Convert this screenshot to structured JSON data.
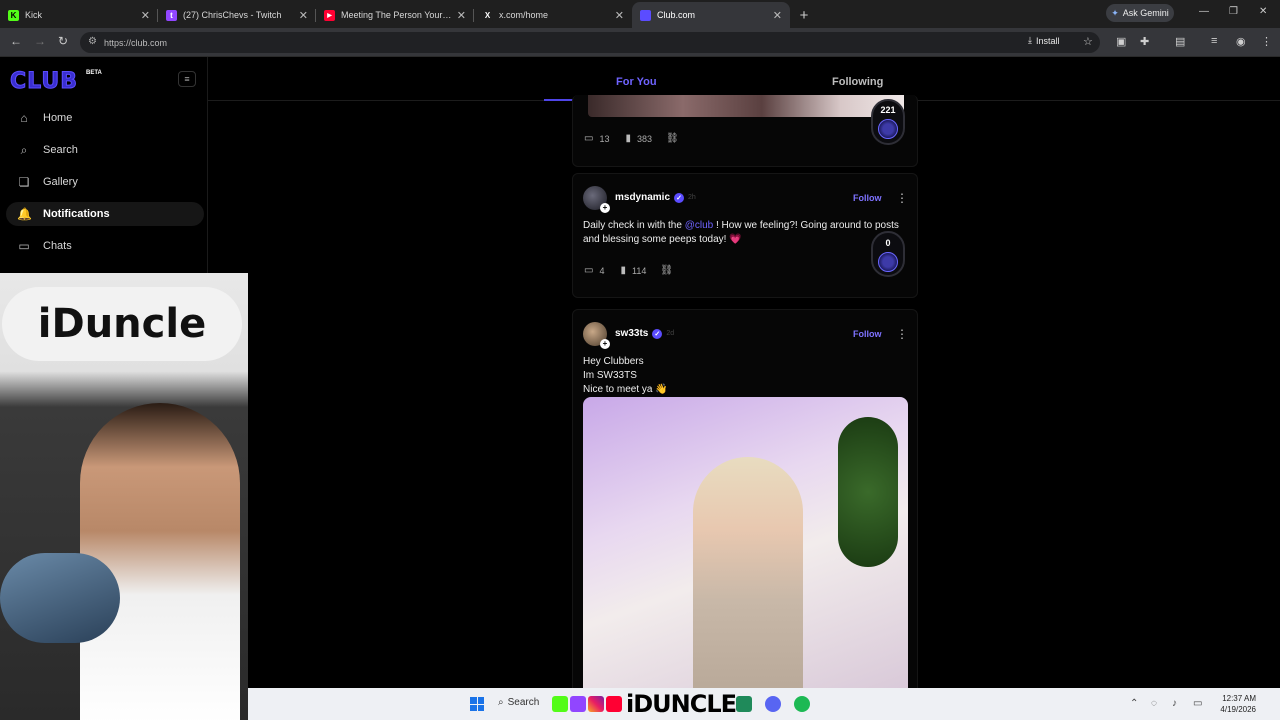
{
  "browser": {
    "tabs": [
      {
        "label": "Kick",
        "favicon_color": "#53fc18",
        "favicon_glyph": "K"
      },
      {
        "label": "(27) ChrisChevs - Twitch",
        "favicon_color": "#9146ff",
        "favicon_glyph": "t"
      },
      {
        "label": "Meeting The Person Your Partn",
        "favicon_color": "#ff0033",
        "favicon_glyph": "▶"
      },
      {
        "label": "x.com/home",
        "favicon_color": "#000000",
        "favicon_glyph": "X"
      },
      {
        "label": "Club.com",
        "favicon_color": "#5b4cff",
        "favicon_glyph": ""
      }
    ],
    "gemini_label": "Ask Gemini",
    "url": "https://club.com",
    "install_label": "Install"
  },
  "sidebar": {
    "logo": "CLUB",
    "beta": "BETA",
    "items": [
      {
        "label": "Home",
        "icon": "home-icon"
      },
      {
        "label": "Search",
        "icon": "search-icon"
      },
      {
        "label": "Gallery",
        "icon": "gallery-icon"
      },
      {
        "label": "Notifications",
        "icon": "bell-icon"
      },
      {
        "label": "Chats",
        "icon": "chat-icon"
      }
    ]
  },
  "feed_tabs": {
    "for_you": "For You",
    "following": "Following"
  },
  "posts": [
    {
      "comments": "13",
      "views": "383",
      "votes": "221"
    },
    {
      "username": "msdynamic",
      "time": "2h",
      "follow_label": "Follow",
      "text_before": "Daily check in with the ",
      "mention": "@club",
      "text_after": " ! How we feeling?! Going around to posts and blessing some peeps today! 💗",
      "comments": "4",
      "views": "114",
      "votes": "0"
    },
    {
      "username": "sw33ts",
      "time": "2d",
      "follow_label": "Follow",
      "lines": [
        "Hey Clubbers",
        "Im SW33TS",
        "Nice to meet ya 👋"
      ]
    }
  ],
  "webcam": {
    "board_text": "iDuncle"
  },
  "taskbar": {
    "search_label": "Search",
    "brand": "iDUNCLE",
    "time": "12:37 AM",
    "date": "4/19/2026"
  },
  "colors": {
    "accent": "#6f63ff",
    "background": "#000000"
  }
}
